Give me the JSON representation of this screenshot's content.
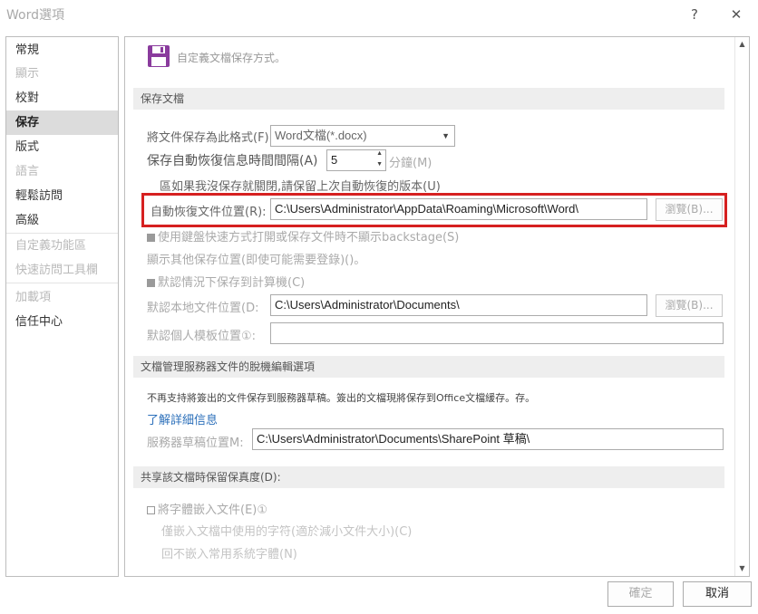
{
  "window": {
    "title": "Word選項",
    "help_label": "?",
    "close_label": "✕"
  },
  "sidebar": {
    "items": [
      {
        "label": "常規",
        "state": "normal"
      },
      {
        "label": "顯示",
        "state": "dim"
      },
      {
        "label": "校對",
        "state": "normal"
      },
      {
        "label": "保存",
        "state": "active"
      },
      {
        "label": "版式",
        "state": "normal"
      },
      {
        "label": "語言",
        "state": "dim"
      },
      {
        "label": "輕鬆訪問",
        "state": "normal"
      },
      {
        "label": "高級",
        "state": "normal"
      },
      {
        "label": "自定義功能區",
        "state": "dim"
      },
      {
        "label": "快速訪問工具欄",
        "state": "dim"
      },
      {
        "label": "加載項",
        "state": "dim"
      },
      {
        "label": "信任中心",
        "state": "normal"
      }
    ]
  },
  "header": {
    "icon": "floppy-disk-icon",
    "text": "自定義文檔保存方式。"
  },
  "save_docs": {
    "section_title": "保存文檔",
    "format_label": "將文件保存為此格式(F):",
    "format_value": "Word文檔(*.docx)",
    "autorecover_label": "保存自動恢復信息時間間隔(A)",
    "autorecover_value": "5",
    "minutes_label": "分鐘(M)",
    "keep_last_label": "區如果我沒保存就關閉,請保留上次自動恢復的版本(U)",
    "autorecover_location_label": "自動恢復文件位置(R):",
    "autorecover_location_value": "C:\\Users\\Administrator\\AppData\\Roaming\\Microsoft\\Word\\",
    "browse_label": "瀏覽(B)...",
    "no_backstage_label": "使用鍵盤快速方式打開或保存文件時不顯示backstage(S)",
    "show_additional_label": "顯示其他保存位置(即使可能需要登錄)()。",
    "default_computer_label": "默認情況下保存到計算機(C)",
    "default_local_label": "默認本地文件位置(D:",
    "default_local_value": "C:\\Users\\Administrator\\Documents\\",
    "browse2_label": "瀏覽(B)...",
    "template_location_label": "默認個人模板位置①:",
    "template_location_value": ""
  },
  "offline": {
    "section_title": "文檔管理服務器文件的脫機編輯選項",
    "note": "不再支持將簽出的文件保存到服務器草稿。簽出的文檔現將保存到Office文檔緩存。存。",
    "learn_more": "了解詳細信息",
    "drafts_label": "服務器草稿位置M:",
    "drafts_value": "C:\\Users\\Administrator\\Documents\\SharePoint 草稿\\"
  },
  "fidelity": {
    "section_title": "共享該文檔時保留保真度(D):",
    "embed_fonts_label": "將字體嵌入文件(E)①",
    "embed_used_only_label": "僅嵌入文檔中使用的字符(適於減小文件大小)(C)",
    "no_common_fonts_label": "回不嵌入常用系統字體(N)"
  },
  "footer": {
    "ok_label": "確定",
    "cancel_label": "取消"
  }
}
